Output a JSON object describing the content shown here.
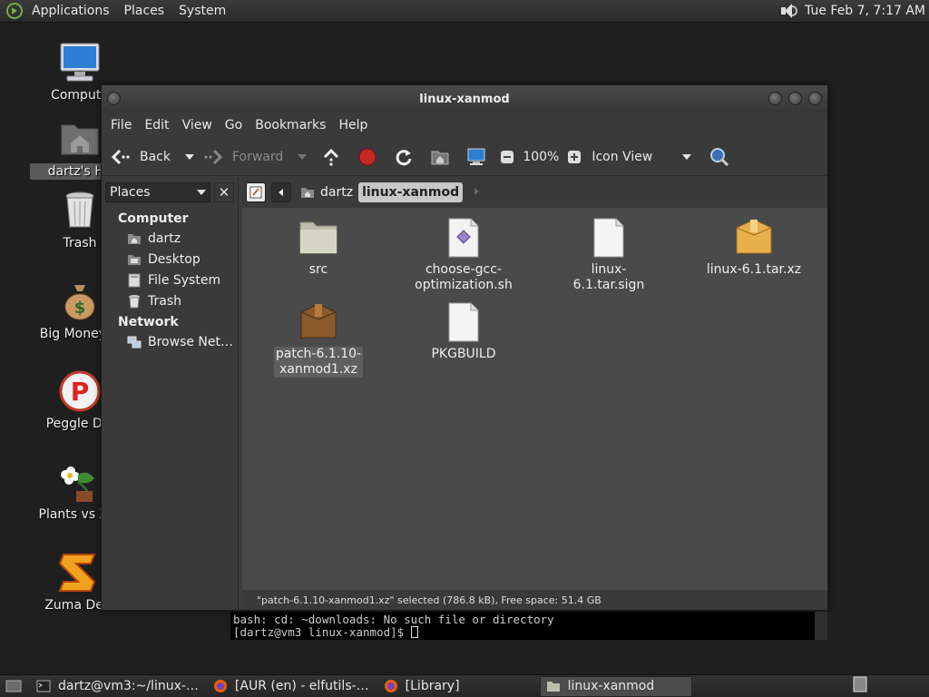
{
  "top_panel": {
    "menus": [
      "Applications",
      "Places",
      "System"
    ],
    "clock": "Tue Feb  7, 7:17 AM"
  },
  "desktop": {
    "icons": [
      {
        "label": "Compute"
      },
      {
        "label": "dartz's Ho"
      },
      {
        "label": "Trash"
      },
      {
        "label": "Big Money D"
      },
      {
        "label": "Peggle Del"
      },
      {
        "label": "Plants vs Zor"
      },
      {
        "label": "Zuma Delu"
      }
    ]
  },
  "window": {
    "title": "linux-xanmod",
    "menus": [
      "File",
      "Edit",
      "View",
      "Go",
      "Bookmarks",
      "Help"
    ],
    "toolbar": {
      "back": "Back",
      "forward": "Forward",
      "zoom": "100%",
      "view_mode": "Icon View"
    },
    "breadcrumb": [
      "dartz",
      "linux-xanmod"
    ],
    "sidebar": {
      "selector": "Places",
      "sections": [
        {
          "title": "Computer",
          "items": [
            "dartz",
            "Desktop",
            "File System",
            "Trash"
          ]
        },
        {
          "title": "Network",
          "items": [
            "Browse Net…"
          ]
        }
      ]
    },
    "files": [
      {
        "name": "src",
        "type": "folder"
      },
      {
        "name": "choose-gcc-\noptimization.sh",
        "type": "script"
      },
      {
        "name": "linux-6.1.tar.sign",
        "type": "doc"
      },
      {
        "name": "linux-6.1.tar.xz",
        "type": "archive"
      },
      {
        "name": "patch-6.1.10-\nxanmod1.xz",
        "type": "archive-brown"
      },
      {
        "name": "PKGBUILD",
        "type": "doc"
      }
    ],
    "status": "\"patch-6.1.10-xanmod1.xz\" selected (786.8 kB), Free space: 51.4 GB"
  },
  "terminal": {
    "line1": "bash: cd: ~downloads: No such file or directory",
    "prompt": "[dartz@vm3 linux-xanmod]$ "
  },
  "taskbar": {
    "tasks": [
      {
        "label": "dartz@vm3:~/linux-…"
      },
      {
        "label": "[AUR (en) - elfutils-…"
      },
      {
        "label": "[Library]"
      },
      {
        "label": "linux-xanmod"
      }
    ]
  },
  "colors": {
    "folder": "#cfcfbf",
    "archive": "#e0a83a",
    "archive_brown": "#8a5a2a",
    "selection": "#5f5f5f"
  }
}
